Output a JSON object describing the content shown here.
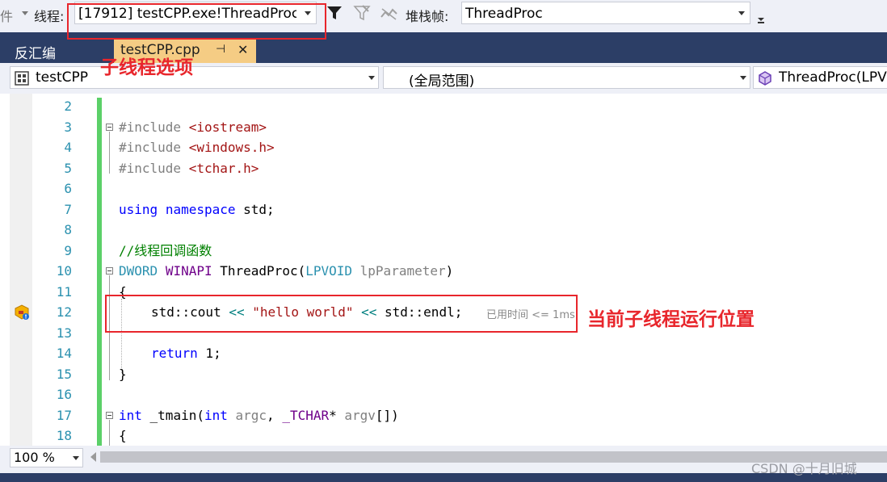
{
  "toolbar": {
    "cut_label": "件",
    "thread_label": "线程:",
    "thread_value": "[17912] testCPP.exe!ThreadProc",
    "stack_label": "堆栈帧:",
    "stack_value": "ThreadProc"
  },
  "tabs": {
    "disasm": "反汇编",
    "file": "testCPP.cpp",
    "pin": "⊣",
    "close": "✕"
  },
  "nav": {
    "project": "testCPP",
    "scope": "(全局范围)",
    "function": "ThreadProc(LPV"
  },
  "code": {
    "line_numbers": [
      "2",
      "3",
      "4",
      "5",
      "6",
      "7",
      "8",
      "9",
      "10",
      "11",
      "12",
      "13",
      "14",
      "15",
      "16",
      "17",
      "18"
    ],
    "l3_pp": "#include",
    "l3_file": "<iostream>",
    "l4_pp": "#include",
    "l4_file": "<windows.h>",
    "l5_pp": "#include",
    "l5_file": "<tchar.h>",
    "l7_kw1": "using",
    "l7_kw2": "namespace",
    "l7_rest": " std;",
    "l9_comment": "//线程回调函数",
    "l10_type": "DWORD",
    "l10_macro": "WINAPI",
    "l10_name": "ThreadProc",
    "l10_paren": "(",
    "l10_ptype": "LPVOID",
    "l10_param": "lpParameter",
    "l10_close": ")",
    "l11_brace": "{",
    "l12_a": "std::cout ",
    "l12_op1": "<<",
    "l12_str": "\"hello world\"",
    "l12_op2": "<<",
    "l12_b": " std::endl;",
    "l12_hint": "已用时间 <= 1ms",
    "l14_kw": "return",
    "l14_rest": " 1;",
    "l15_brace": "}",
    "l17_kw1": "int",
    "l17_name": " _tmain(",
    "l17_kw2": "int",
    "l17_arg1": " argc",
    "l17_comma": ", ",
    "l17_type": "_TCHAR",
    "l17_star": "* ",
    "l17_arg2": "argv",
    "l17_end": "[])",
    "l18_brace": "{"
  },
  "bottom": {
    "zoom": "100 %"
  },
  "annotations": {
    "thread_option": "子线程选项",
    "current_position": "当前子线程运行位置"
  },
  "watermark": "CSDN @十月旧城",
  "colors": {
    "accent_red": "#e8262c",
    "tab_bar": "#2c3e66",
    "active_tab": "#f5cc84",
    "change_bar": "#5bd068"
  }
}
